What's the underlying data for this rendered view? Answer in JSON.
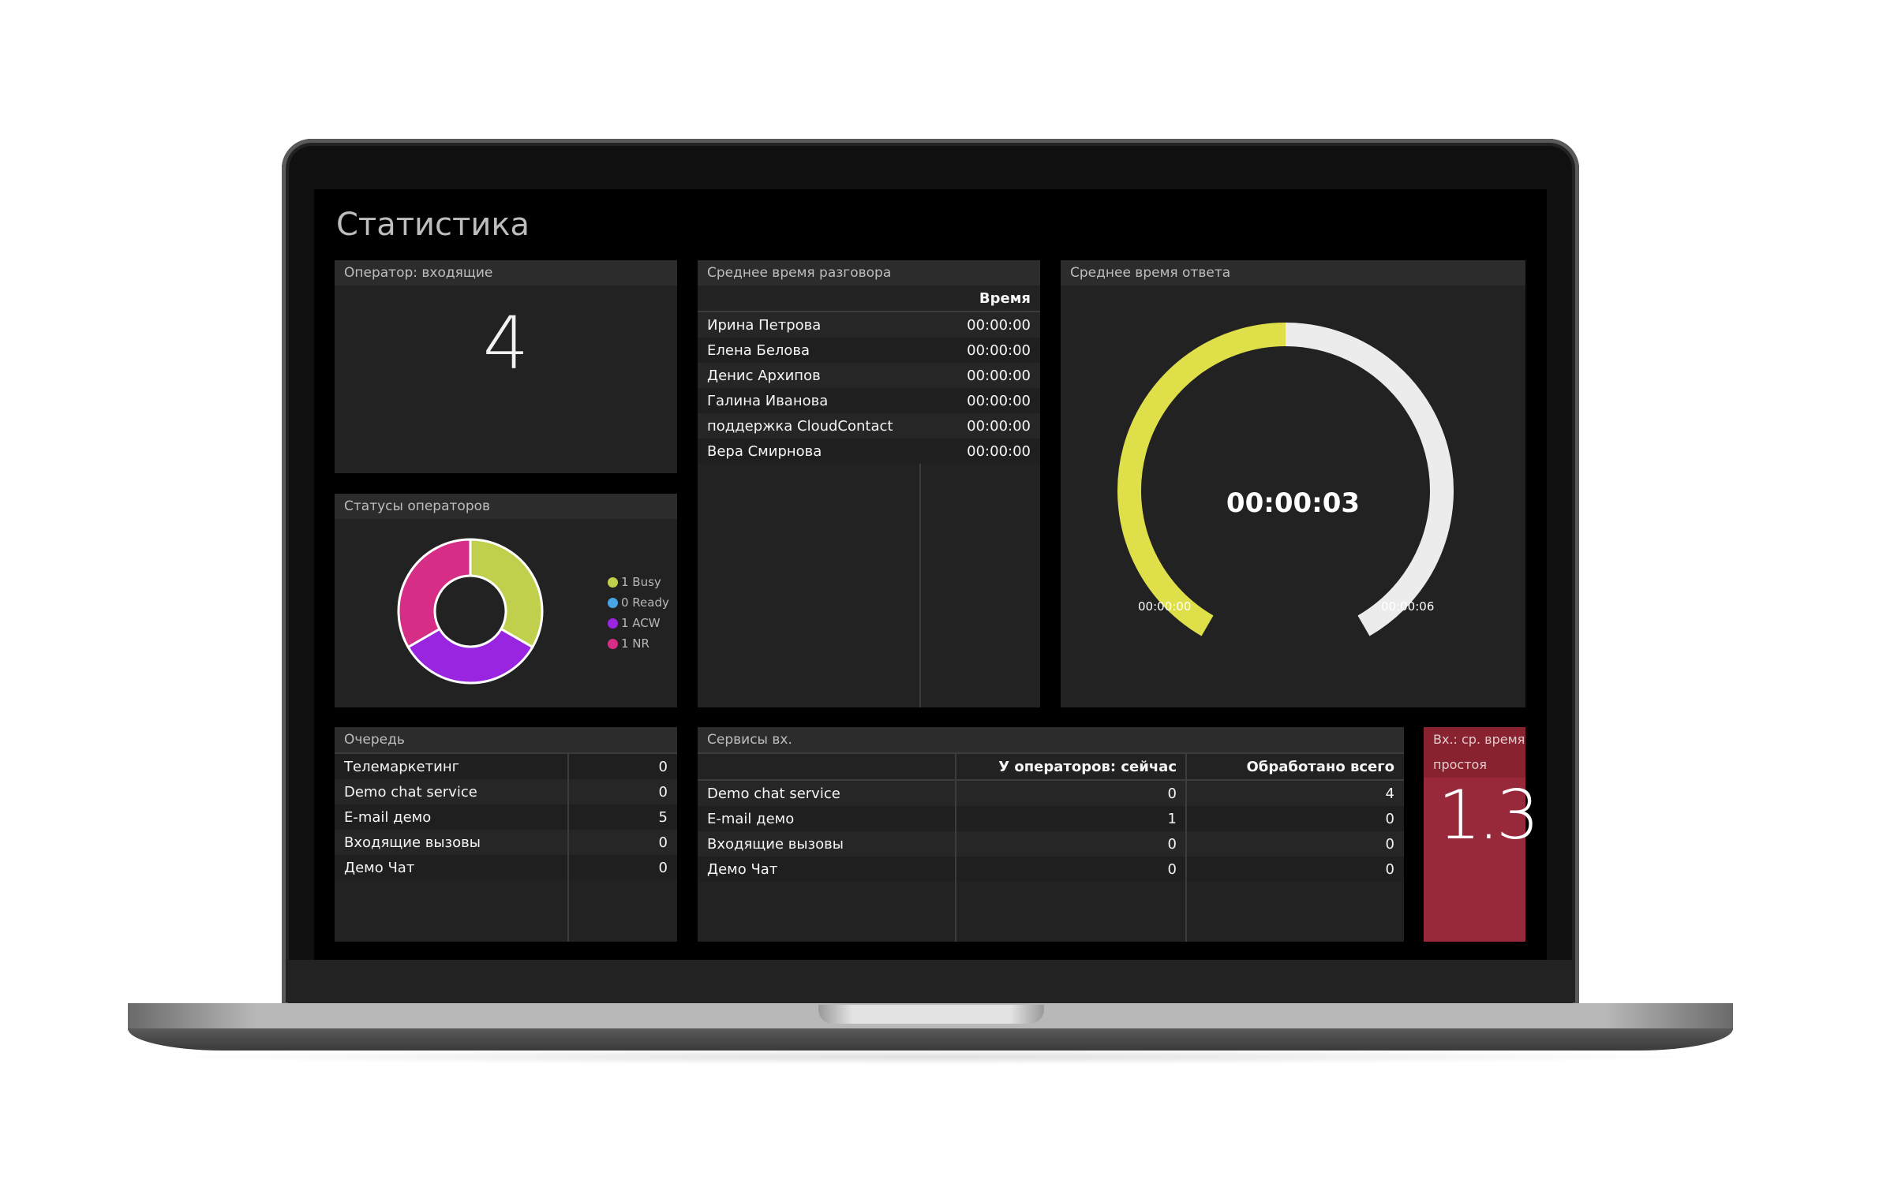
{
  "page": {
    "title": "Статистика"
  },
  "operator_incoming": {
    "title": "Оператор: входящие",
    "value": "4"
  },
  "avg_talk_time": {
    "title": "Среднее время разговора",
    "columns": [
      "",
      "Время"
    ],
    "rows": [
      {
        "name": "Ирина Петрова",
        "time": "00:00:00"
      },
      {
        "name": "Елена Белова",
        "time": "00:00:00"
      },
      {
        "name": "Денис Архипов",
        "time": "00:00:00"
      },
      {
        "name": "Галина Иванова",
        "time": "00:00:00"
      },
      {
        "name": "поддержка CloudContact",
        "time": "00:00:00"
      },
      {
        "name": "Вера Смирнова",
        "time": "00:00:00"
      }
    ]
  },
  "avg_answer_time": {
    "title": "Среднее время ответа",
    "value": "00:00:03",
    "min_label": "00:00:00",
    "max_label": "00:00:06",
    "fraction": 0.5,
    "colors": {
      "fill": "#dfdf4a",
      "track": "#ececec"
    }
  },
  "operator_statuses": {
    "title": "Статусы операторов",
    "legend": [
      {
        "label": "1 Busy",
        "color": "#c0d04c"
      },
      {
        "label": "0 Ready",
        "color": "#48a6e6"
      },
      {
        "label": "1 ACW",
        "color": "#9a25e0"
      },
      {
        "label": "1 NR",
        "color": "#d62e86"
      }
    ]
  },
  "queue": {
    "title": "Очередь",
    "rows": [
      {
        "name": "Телемаркетинг",
        "value": "0"
      },
      {
        "name": "Demo chat service",
        "value": "0"
      },
      {
        "name": "E-mail демо",
        "value": "5"
      },
      {
        "name": "Входящие вызовы",
        "value": "0"
      },
      {
        "name": "Демо Чат",
        "value": "0"
      }
    ]
  },
  "services_incoming": {
    "title": "Сервисы вх.",
    "columns": [
      "",
      "У операторов: сейчас",
      "Обработано всего"
    ],
    "rows": [
      {
        "name": "Demo chat service",
        "now": "0",
        "total": "4"
      },
      {
        "name": "E-mail демо",
        "now": "1",
        "total": "0"
      },
      {
        "name": "Входящие вызовы",
        "now": "0",
        "total": "0"
      },
      {
        "name": "Демо Чат",
        "now": "0",
        "total": "0"
      }
    ]
  },
  "avg_idle_time": {
    "title": "Вх.: ср. время простоя",
    "value": "1.3",
    "color": "#97293a"
  },
  "chart_data": [
    {
      "type": "pie",
      "title": "Статусы операторов",
      "categories": [
        "Busy",
        "Ready",
        "ACW",
        "NR"
      ],
      "values": [
        1,
        0,
        1,
        1
      ],
      "colors": [
        "#c0d04c",
        "#48a6e6",
        "#9a25e0",
        "#d62e86"
      ],
      "donut": true,
      "legend": "right"
    },
    {
      "type": "gauge",
      "title": "Среднее время ответа",
      "value_seconds": 3,
      "range_seconds": [
        0,
        6
      ],
      "value_label": "00:00:03"
    }
  ]
}
